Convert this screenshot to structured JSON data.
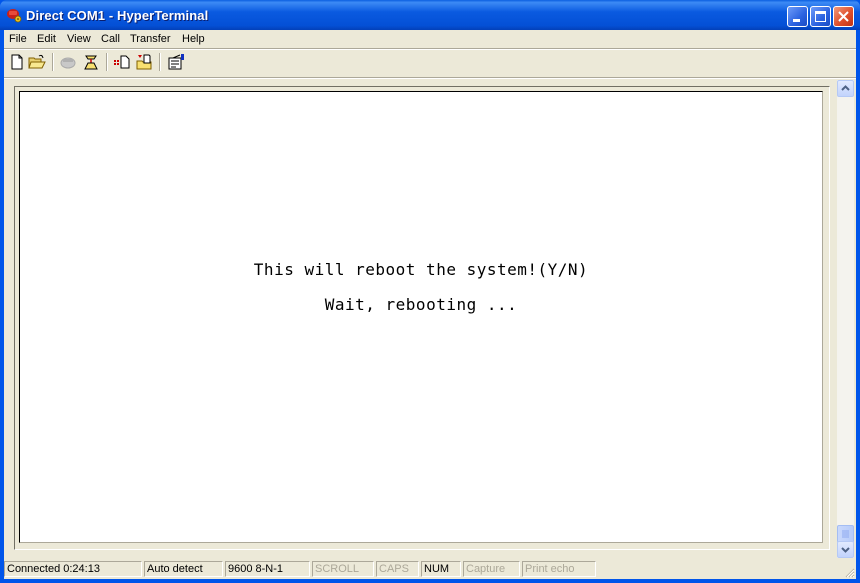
{
  "window": {
    "title": "Direct COM1 - HyperTerminal",
    "icon": "hyperterminal-phone-icon",
    "controls": {
      "minimize": "minimize-icon",
      "maximize": "maximize-icon",
      "close": "close-icon"
    }
  },
  "menubar": {
    "items": [
      {
        "label": "File"
      },
      {
        "label": "Edit"
      },
      {
        "label": "View"
      },
      {
        "label": "Call"
      },
      {
        "label": "Transfer"
      },
      {
        "label": "Help"
      }
    ]
  },
  "toolbar": {
    "buttons": [
      {
        "name": "new-connection",
        "icon": "new-document-icon",
        "enabled": true
      },
      {
        "name": "open",
        "icon": "open-folder-icon",
        "enabled": true
      },
      {
        "name": "connect",
        "icon": "phone-icon",
        "enabled": false
      },
      {
        "name": "disconnect",
        "icon": "hangup-icon",
        "enabled": true
      },
      {
        "name": "send-file",
        "icon": "send-file-icon",
        "enabled": true
      },
      {
        "name": "receive-file",
        "icon": "receive-file-icon",
        "enabled": true
      },
      {
        "name": "properties",
        "icon": "properties-icon",
        "enabled": true
      }
    ]
  },
  "terminal": {
    "lines": [
      "This will reboot the system!(Y/N)",
      "Wait, rebooting ..."
    ]
  },
  "statusbar": {
    "connection": "Connected 0:24:13",
    "detect": "Auto detect",
    "port_settings": "9600 8-N-1",
    "scroll": "SCROLL",
    "caps": "CAPS",
    "num": "NUM",
    "capture": "Capture",
    "print_echo": "Print echo"
  },
  "scroll": {
    "position_fraction": 1.0
  }
}
